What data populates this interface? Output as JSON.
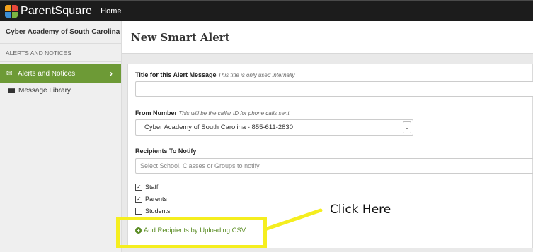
{
  "topbar": {
    "brand": "ParentSquare",
    "home_label": "Home"
  },
  "sidebar": {
    "school": "Cyber Academy of South Carolina",
    "section_header": "ALERTS AND NOTICES",
    "active_item": "Alerts and Notices",
    "items": [
      {
        "label": "Message Library"
      }
    ]
  },
  "main": {
    "title": "New Smart Alert",
    "title_field": {
      "label": "Title for this Alert Message",
      "hint": "This title is only used internally",
      "value": ""
    },
    "from_field": {
      "label": "From Number",
      "hint": "This will be the caller ID for phone calls sent.",
      "value": "Cyber Academy of South Carolina - 855-611-2830"
    },
    "recipients": {
      "label": "Recipients To Notify",
      "placeholder": "Select School, Classes or Groups to notify",
      "options": [
        {
          "label": "Staff",
          "checked": true
        },
        {
          "label": "Parents",
          "checked": true
        },
        {
          "label": "Students",
          "checked": false
        }
      ]
    },
    "csv_link": "Add Recipients by Uploading CSV"
  },
  "annotation": {
    "callout": "Click Here",
    "highlight_color": "#f5ee1f"
  },
  "colors": {
    "accent": "#6d9a36",
    "link": "#5b8d25",
    "topbar": "#1c1c1c"
  }
}
